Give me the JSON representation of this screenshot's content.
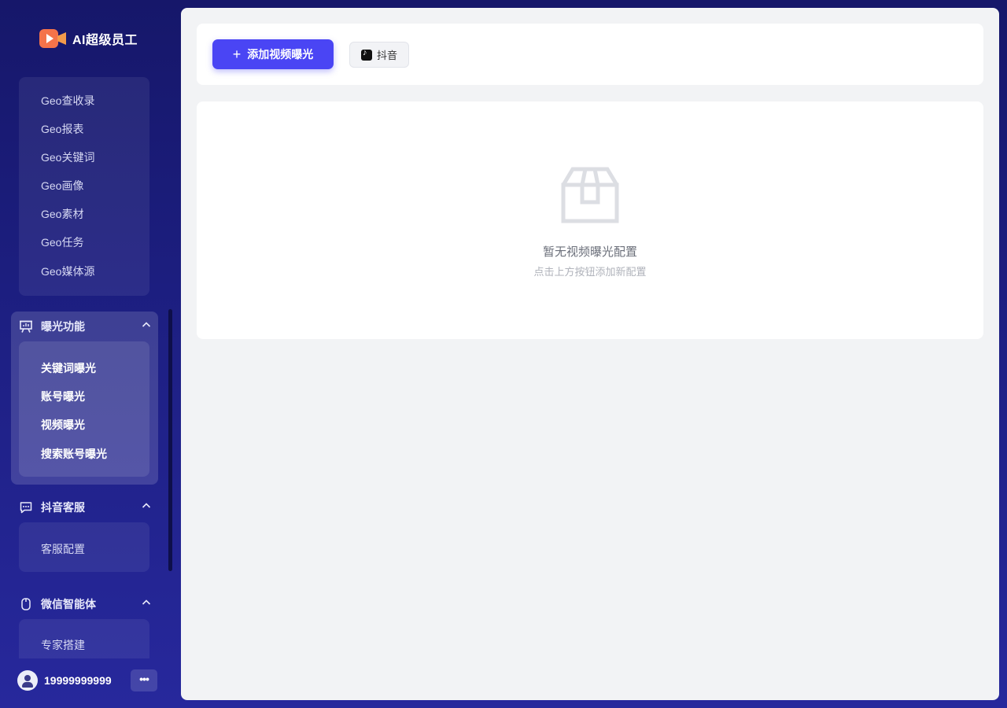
{
  "brand": {
    "name": "AI超级员工",
    "logo_icon": "video-camera-icon"
  },
  "sidebar": {
    "geo_items": [
      "Geo查收录",
      "Geo报表",
      "Geo关键词",
      "Geo画像",
      "Geo素材",
      "Geo任务",
      "Geo媒体源"
    ],
    "groups": [
      {
        "title": "曝光功能",
        "icon": "presentation-icon",
        "expanded": true,
        "active": true,
        "items": [
          "关键词曝光",
          "账号曝光",
          "视频曝光",
          "搜索账号曝光"
        ]
      },
      {
        "title": "抖音客服",
        "icon": "chat-icon",
        "expanded": true,
        "items": [
          "客服配置"
        ]
      },
      {
        "title": "微信智能体",
        "icon": "mouse-icon",
        "expanded": true,
        "items": [
          "专家搭建"
        ]
      }
    ]
  },
  "user": {
    "phone": "19999999999",
    "more_label": "•••"
  },
  "toolbar": {
    "add_button_label": "添加视频曝光",
    "platform_tag_label": "抖音",
    "accent_color": "#4a45f4"
  },
  "empty_state": {
    "title": "暂无视频曝光配置",
    "hint": "点击上方按钮添加新配置",
    "icon": "empty-box-icon"
  }
}
